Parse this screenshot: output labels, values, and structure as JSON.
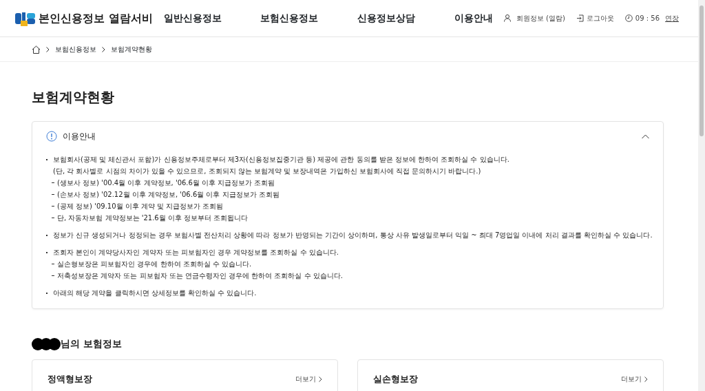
{
  "header": {
    "site_title": "본인신용정보 열람서비",
    "nav": [
      "일반신용정보",
      "보험신용정보",
      "신용정보상담",
      "이용안내"
    ],
    "member_info": "회원정보 (열람)",
    "logout": "로그아웃",
    "timer": "09 : 56",
    "extend": "연장"
  },
  "breadcrumb": [
    "보험신용정보",
    "보험계약현황"
  ],
  "page_title": "보험계약현황",
  "notice": {
    "title": "이용안내",
    "expanded": true,
    "items": [
      {
        "text": "보험회사(공제 및 체신관서 포함)가 신용정보주체로부터 제3자(신용정보집중기관 등) 제공에 관한 동의를 받은 정보에 한하여 조회하실 수 있습니다.",
        "note": "(단, 각 회사별로 시점의 차이가 있을 수 있으므로, 조회되지 않는 보험계약 및 보장내역은 가입하신 보험회사에 직접 문의하시기 바랍니다.)",
        "children": [
          "(생보사 정보) '00.4월 이후 계약정보, '06.6월 이후 지급정보가 조회됨",
          "(손보사 정보) '02.12월 이후 계약정보, '06.6월 이후 지급정보가 조회됨",
          "(공제 정보) '09.10월 이후 계약 및 지급정보가 조회됨",
          "단, 자동차보험 계약정보는 '21.6월 이후 정보부터 조회됩니다"
        ]
      },
      {
        "text": "정보가 신규 생성되거나 정정되는 경우 보험사별 전산처리 상황에 따라 정보가 반영되는 기간이 상이하며, 통상 사유 발생일로부터 익일 ~ 최대 7영업일 이내에 처리 결과를 확인하실 수 있습니다."
      },
      {
        "text": "조회자 본인이 계약당사자인 계약자 또는 피보험자인 경우 계약정보를 조회하실 수 있습니다.",
        "children": [
          "실손형보장은 피보험자인 경우에 한하여 조회하실 수 있습니다.",
          "저축성보장은 계약자 또는 피보험자 또는 연금수령자인 경우에 한하여 조회하실 수 있습니다."
        ]
      },
      {
        "text": "아래의 해당 계약을 클릭하시면 상세정보를 확인하실 수 있습니다."
      }
    ]
  },
  "section_title": "님의 보험정보",
  "cards": [
    {
      "title": "정액형보장",
      "more": "더보기"
    },
    {
      "title": "실손형보장",
      "more": "더보기"
    }
  ]
}
